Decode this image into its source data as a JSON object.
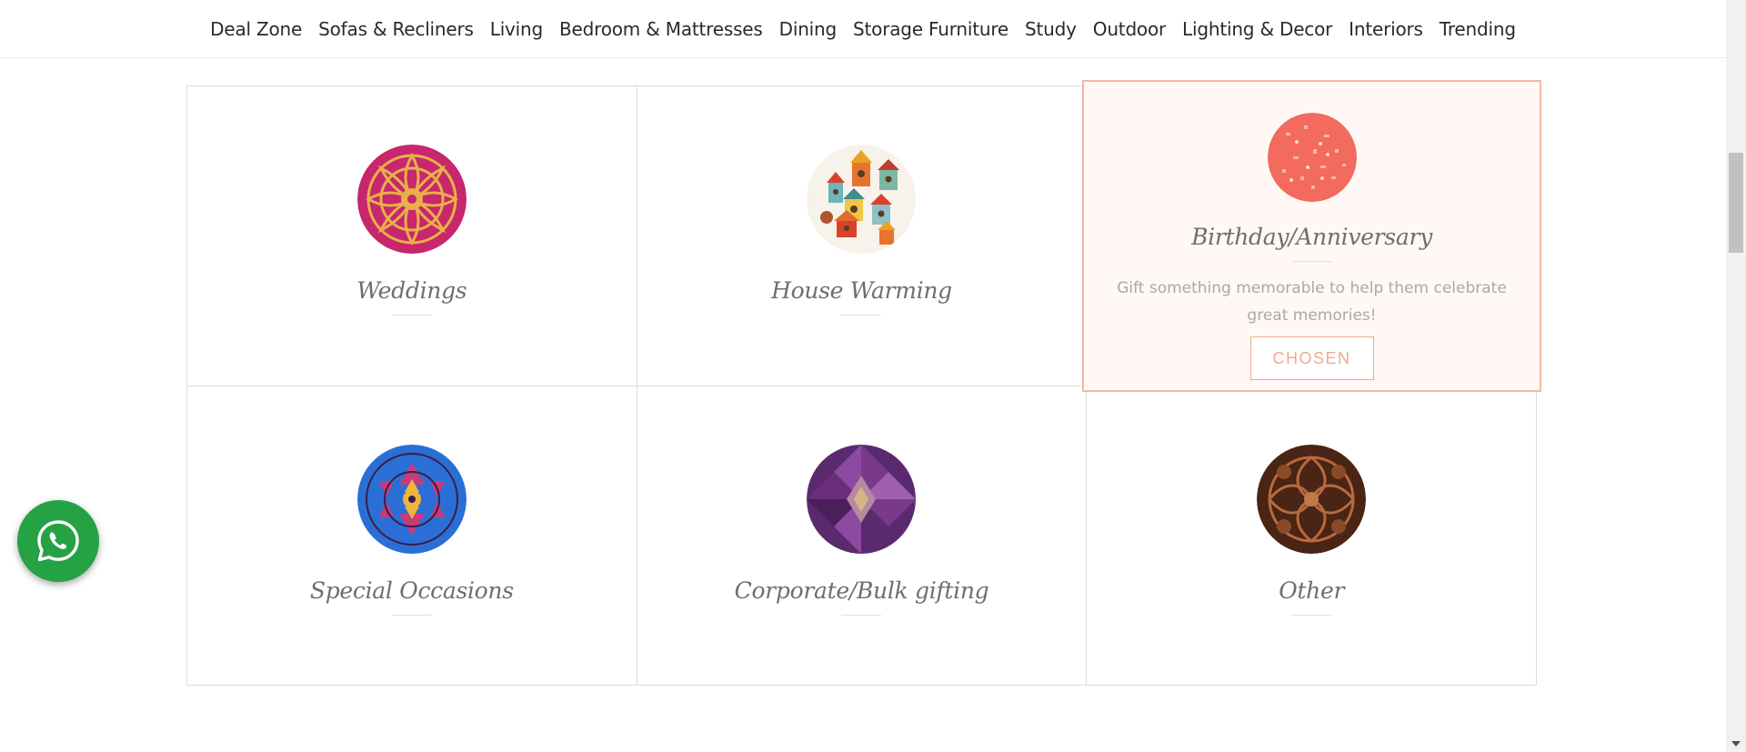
{
  "nav": {
    "items": [
      "Deal Zone",
      "Sofas & Recliners",
      "Living",
      "Bedroom & Mattresses",
      "Dining",
      "Storage Furniture",
      "Study",
      "Outdoor",
      "Lighting & Decor",
      "Interiors",
      "Trending"
    ]
  },
  "occasions": [
    {
      "title": "Weddings",
      "image": "pink-mandala-pattern"
    },
    {
      "title": "House Warming",
      "image": "birdhouses-pattern"
    },
    {
      "title": "Birthday/Anniversary",
      "image": "coral-confetti-pattern",
      "description": "Gift something memorable to help them celebrate great memories!",
      "button": "CHOSEN",
      "selected": true
    },
    {
      "title": "Special Occasions",
      "image": "kaleidoscope-pattern"
    },
    {
      "title": "Corporate/Bulk gifting",
      "image": "purple-geometric-pattern"
    },
    {
      "title": "Other",
      "image": "brown-ornament-pattern"
    }
  ],
  "floating": {
    "icon": "whatsapp-icon"
  },
  "colors": {
    "accent": "#f0a98f",
    "chosen_bg": "#fff8f5",
    "whatsapp": "#25a244"
  }
}
